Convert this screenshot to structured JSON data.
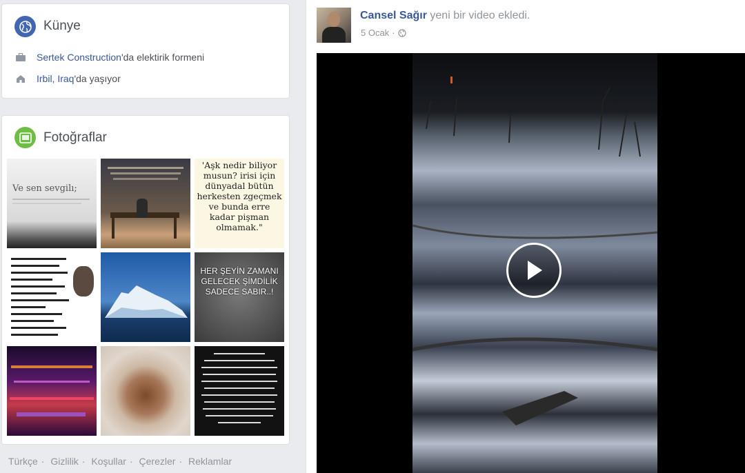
{
  "intro": {
    "title": "Künye",
    "work_link": "Sertek Construction",
    "work_suffix": "'da elektirik formeni",
    "lives_link": "Irbil, Iraq",
    "lives_suffix": "'da yaşıyor"
  },
  "photos": {
    "title": "Fotoğraflar",
    "tiles": [
      {
        "caption": "Ve sen sevgilı;"
      },
      {
        "caption": ""
      },
      {
        "caption": "'Aşk nedir biliyor musun? irisi için dünyadal bütün herkesten zgeçmek ve bunda erre kadar pişman olmamak.\""
      },
      {
        "caption": ""
      },
      {
        "caption": ""
      },
      {
        "caption": "HER ŞEYİN ZAMANI GELECEK ŞİMDİLİK SADECE SABIR..!"
      },
      {
        "caption": ""
      },
      {
        "caption": ""
      },
      {
        "caption": ""
      }
    ]
  },
  "footer": {
    "links": [
      "Türkçe",
      "Gizlilik",
      "Koşullar",
      "Çerezler",
      "Reklamlar"
    ]
  },
  "post": {
    "author": "Cansel Sağır",
    "action": "yeni bir video ekledi.",
    "date": "5 Ocak",
    "privacy_icon": "globe-icon",
    "video_icon": "play-icon"
  },
  "colors": {
    "page_bg": "#e9ebee",
    "link": "#365899",
    "intro_icon_bg": "#4267b2",
    "photos_icon_bg": "#6ebd45"
  }
}
